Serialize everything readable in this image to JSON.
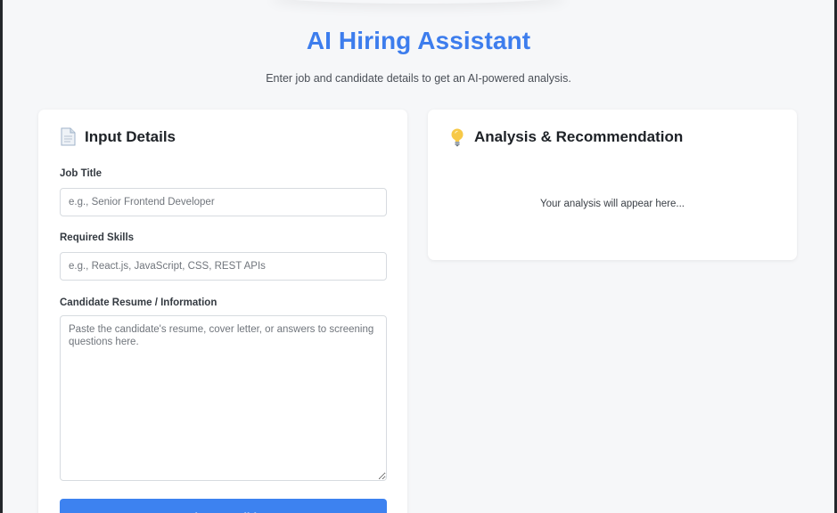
{
  "header": {
    "title": "AI Hiring Assistant",
    "subtitle": "Enter job and candidate details to get an AI-powered analysis."
  },
  "input_card": {
    "icon": "document-icon",
    "heading": "Input Details",
    "job_title": {
      "label": "Job Title",
      "value": "",
      "placeholder": "e.g., Senior Frontend Developer"
    },
    "required_skills": {
      "label": "Required Skills",
      "value": "",
      "placeholder": "e.g., React.js, JavaScript, CSS, REST APIs"
    },
    "candidate_info": {
      "label": "Candidate Resume / Information",
      "value": "",
      "placeholder": "Paste the candidate's resume, cover letter, or answers to screening questions here."
    },
    "analyze_button": "Analyze Candidate"
  },
  "analysis_card": {
    "icon": "lightbulb-icon",
    "heading": "Analysis & Recommendation",
    "placeholder_text": "Your analysis will appear here..."
  },
  "colors": {
    "accent": "#3d7ded",
    "button": "#3d82f0",
    "page_background": "#f6f7f9",
    "card_background": "#ffffff"
  }
}
